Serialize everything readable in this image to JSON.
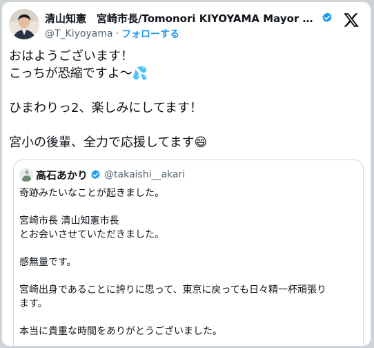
{
  "author": {
    "display_name": "清山知憲　宮崎市長/Tomonori KIYOYAMA Mayor of Miy...",
    "handle": "@T_Kiyoyama",
    "separator": "·",
    "follow_label": "フォローする",
    "verified": true
  },
  "platform_icon": "x-logo-icon",
  "tweet": {
    "line1": "おはようございます！",
    "line2": "こっちが恐縮ですよ〜💦",
    "line3": "ひまわりっ2、楽しみにしてます！",
    "line4": "宮小の後輩、全力で応援してます😄"
  },
  "quote": {
    "display_name": "高石あかり",
    "handle": "@takaishi__akari",
    "verified": true,
    "body": {
      "p1": "奇跡みたいなことが起きました。",
      "p2a": "宮崎市長 清山知憲市長",
      "p2b": "とお会いさせていただきました。",
      "p3": "感無量です。",
      "p4a": "宮崎出身であることに誇りに思って、東京に戻っても日々精一杯頑張り",
      "p4b": "ます。",
      "p5": "本当に貴重な時間をありがとうございました。"
    }
  },
  "colors": {
    "accent": "#1d9bf0",
    "text": "#0f1419",
    "secondary": "#536471",
    "border": "#cfd9de"
  }
}
